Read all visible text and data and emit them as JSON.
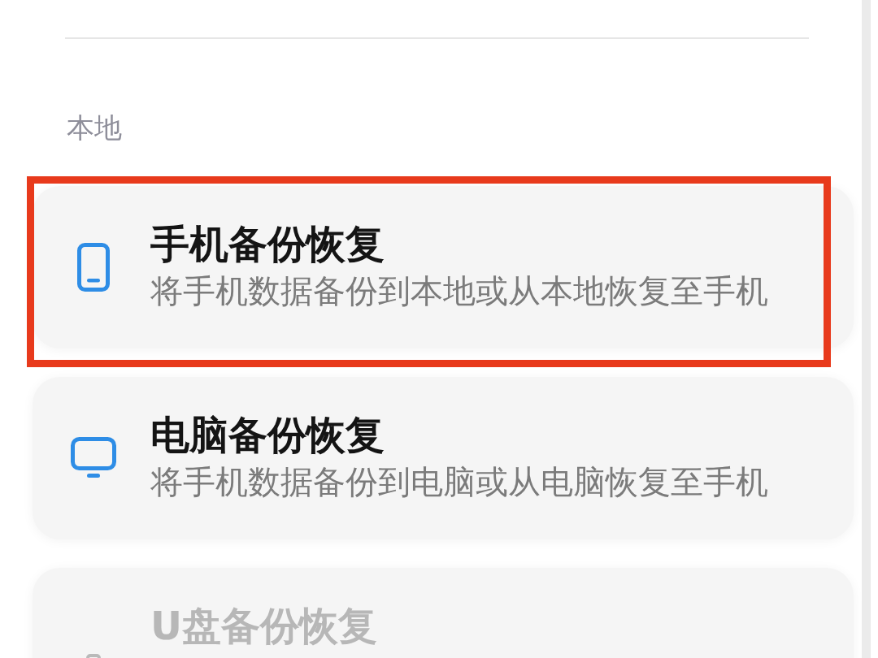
{
  "sections": [
    {
      "label": "本地",
      "items": [
        {
          "title": "手机备份恢复",
          "subtitle": "将手机数据备份到本地或从本地恢复至手机",
          "disabled": false,
          "highlighted": true
        },
        {
          "title": "电脑备份恢复",
          "subtitle": "将手机数据备份到电脑或从电脑恢复至手机",
          "disabled": false,
          "highlighted": false
        },
        {
          "title": "U盘备份恢复",
          "disabled": true,
          "highlighted": false
        }
      ]
    }
  ]
}
